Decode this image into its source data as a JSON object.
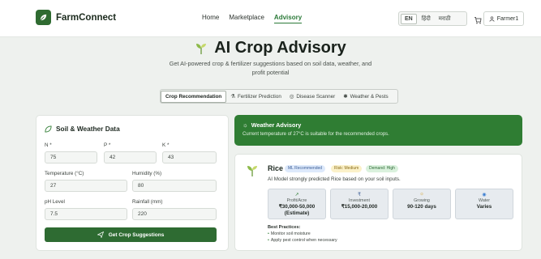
{
  "brand": {
    "name": "FarmConnect"
  },
  "nav": {
    "home": "Home",
    "marketplace": "Marketplace",
    "advisory": "Advisory"
  },
  "lang": {
    "en": "EN",
    "hi": "हिंदी",
    "mr": "मराठी"
  },
  "user": {
    "name": "Farmer1"
  },
  "hero": {
    "title": "AI Crop Advisory",
    "subtitle": "Get AI-powered crop & fertilizer suggestions based on soil data, weather, and profit potential"
  },
  "tabs": [
    {
      "label": "Crop Recommendation"
    },
    {
      "label": "Fertilizer Prediction"
    },
    {
      "label": "Disease Scanner"
    },
    {
      "label": "Weather & Pests"
    }
  ],
  "soil": {
    "title": "Soil & Weather Data",
    "n_label": "N *",
    "n_value": "75",
    "p_label": "P *",
    "p_value": "42",
    "k_label": "K *",
    "k_value": "43",
    "temp_label": "Temperature (°C)",
    "temp_value": "27",
    "humidity_label": "Humidity (%)",
    "humidity_value": "80",
    "ph_label": "pH Level",
    "ph_value": "7.5",
    "rain_label": "Rainfall (mm)",
    "rain_value": "220",
    "button": "Get Crop Suggestions"
  },
  "weather": {
    "title": "Weather Advisory",
    "text": "Current temperature of 27°C is suitable for the recommended crops."
  },
  "recommendation": {
    "crop": "Rice",
    "badge_ml": "ML Recommended",
    "badge_risk": "Risk: Medium",
    "badge_demand": "Demand: High",
    "description": "AI Model strongly predicted Rice based on your soil inputs.",
    "stats": [
      {
        "label": "Profit/Acre",
        "value": "₹30,000-50,000 (Estimate)"
      },
      {
        "label": "Investment",
        "value": "₹15,000-20,000"
      },
      {
        "label": "Growing",
        "value": "90-120 days"
      },
      {
        "label": "Water",
        "value": "Varies"
      }
    ],
    "practices_title": "Best Practices:",
    "practices": [
      "Monitor soil moisture",
      "Apply pest control when necessary"
    ]
  },
  "colors": {
    "primary": "#2e6b32",
    "accent": "#2f7d33",
    "background": "#eef1ee"
  }
}
